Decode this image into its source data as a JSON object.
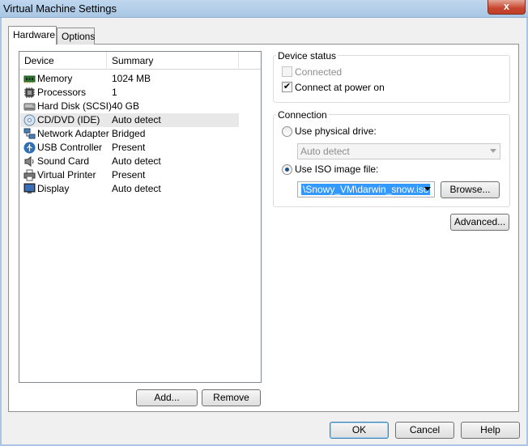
{
  "window": {
    "title": "Virtual Machine Settings",
    "close_label": "x"
  },
  "tabs": [
    {
      "label": "Hardware",
      "active": true
    },
    {
      "label": "Options",
      "active": false
    }
  ],
  "device_list": {
    "headers": {
      "device": "Device",
      "summary": "Summary"
    },
    "rows": [
      {
        "device": "Memory",
        "summary": "1024 MB",
        "icon": "memory-icon"
      },
      {
        "device": "Processors",
        "summary": "1",
        "icon": "processor-icon"
      },
      {
        "device": "Hard Disk (SCSI)",
        "summary": "40 GB",
        "icon": "hard-disk-icon"
      },
      {
        "device": "CD/DVD (IDE)",
        "summary": "Auto detect",
        "icon": "cd-dvd-icon",
        "selected": true
      },
      {
        "device": "Network Adapter",
        "summary": "Bridged",
        "icon": "network-adapter-icon"
      },
      {
        "device": "USB Controller",
        "summary": "Present",
        "icon": "usb-icon"
      },
      {
        "device": "Sound Card",
        "summary": "Auto detect",
        "icon": "speaker-icon"
      },
      {
        "device": "Virtual Printer",
        "summary": "Present",
        "icon": "printer-icon"
      },
      {
        "device": "Display",
        "summary": "Auto detect",
        "icon": "monitor-icon"
      }
    ]
  },
  "list_buttons": {
    "add": "Add...",
    "remove": "Remove"
  },
  "device_status": {
    "label": "Device status",
    "connected": {
      "label": "Connected",
      "checked": false,
      "disabled": true
    },
    "connect_at_power_on": {
      "label": "Connect at power on",
      "checked": true
    }
  },
  "connection": {
    "label": "Connection",
    "physical_drive": {
      "label": "Use physical drive:",
      "selected": false,
      "value": "Auto detect"
    },
    "iso_image": {
      "label": "Use ISO image file:",
      "selected": true,
      "value": "\\Snowy_VM\\darwin_snow.iso"
    },
    "browse": "Browse..."
  },
  "advanced": "Advanced...",
  "footer": {
    "ok": "OK",
    "cancel": "Cancel",
    "help": "Help"
  },
  "colors": {
    "accent": "#3399ff",
    "selection": "#e8e8e8",
    "close": "#c7452e"
  }
}
